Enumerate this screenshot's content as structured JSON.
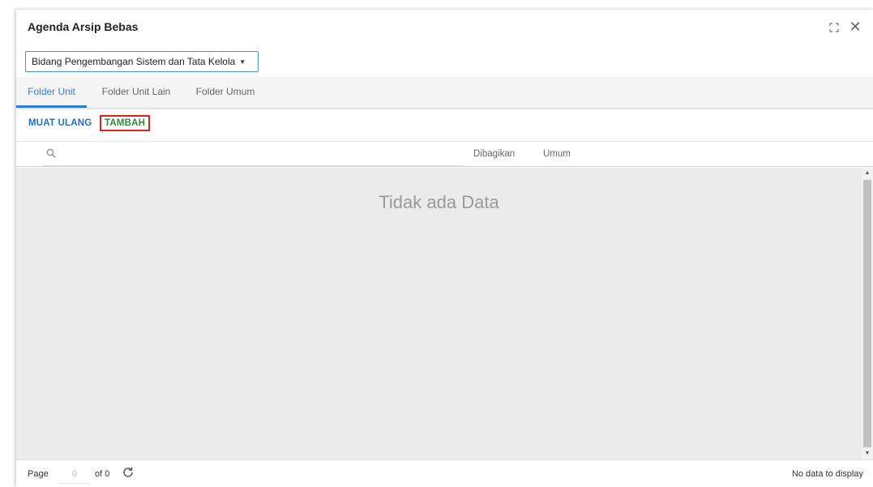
{
  "window": {
    "title": "Agenda Arsip Bebas",
    "maximize_icon": "maximize-icon",
    "close_icon": "close-icon"
  },
  "unit_select": {
    "value": "Bidang Pengembangan Sistem dan Tata Kelola"
  },
  "tabs": [
    {
      "label": "Folder Unit",
      "active": true
    },
    {
      "label": "Folder Unit Lain",
      "active": false
    },
    {
      "label": "Folder Umum",
      "active": false
    }
  ],
  "toolbar": {
    "reload_label": "MUAT ULANG",
    "add_label": "TAMBAH"
  },
  "grid": {
    "search_placeholder": "",
    "columns": [
      "Dibagikan",
      "Umum"
    ],
    "empty_text": "Tidak ada Data"
  },
  "pager": {
    "page_label": "Page",
    "page_value": "0",
    "of_label": "of 0",
    "info": "No data to display"
  },
  "colors": {
    "accent": "#2f7ed8",
    "add_text": "#2e8b3a",
    "highlight_border": "#e01f1f",
    "body_bg": "#ebebeb"
  }
}
